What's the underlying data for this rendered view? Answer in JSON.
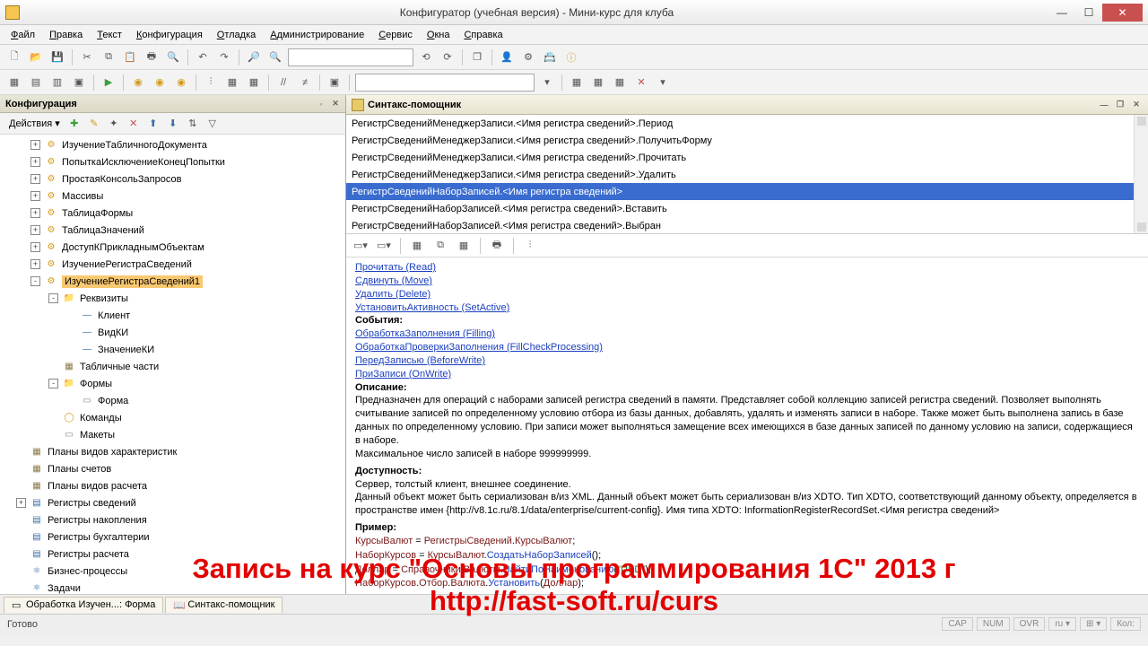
{
  "window": {
    "title": "Конфигуратор (учебная версия) - Мини-курс для клуба"
  },
  "menu": [
    "Файл",
    "Правка",
    "Текст",
    "Конфигурация",
    "Отладка",
    "Администрирование",
    "Сервис",
    "Окна",
    "Справка"
  ],
  "config_panel": {
    "title": "Конфигурация",
    "actions_label": "Действия ▾",
    "tree": [
      {
        "pad": 0,
        "pm": "+",
        "icon": "gear",
        "text": "ИзучениеТабличногоДокумента"
      },
      {
        "pad": 0,
        "pm": "+",
        "icon": "gear",
        "text": "ПопыткаИсключениеКонецПопытки"
      },
      {
        "pad": 0,
        "pm": "+",
        "icon": "gear",
        "text": "ПростаяКонсольЗапросов"
      },
      {
        "pad": 0,
        "pm": "+",
        "icon": "gear",
        "text": "Массивы"
      },
      {
        "pad": 0,
        "pm": "+",
        "icon": "gear",
        "text": "ТаблицаФормы"
      },
      {
        "pad": 0,
        "pm": "+",
        "icon": "gear",
        "text": "ТаблицаЗначений"
      },
      {
        "pad": 0,
        "pm": "+",
        "icon": "gear",
        "text": "ДоступКПрикладнымОбъектам"
      },
      {
        "pad": 0,
        "pm": "+",
        "icon": "gear",
        "text": "ИзучениеРегистраСведений"
      },
      {
        "pad": 0,
        "pm": "-",
        "icon": "gear",
        "text": "ИзучениеРегистраСведений1",
        "selected": true
      },
      {
        "pad": 1,
        "pm": "-",
        "icon": "folder",
        "text": "Реквизиты"
      },
      {
        "pad": 2,
        "pm": "",
        "icon": "dash",
        "text": "Клиент"
      },
      {
        "pad": 2,
        "pm": "",
        "icon": "dash",
        "text": "ВидКИ"
      },
      {
        "pad": 2,
        "pm": "",
        "icon": "dash",
        "text": "ЗначениеКИ"
      },
      {
        "pad": 1,
        "pm": "",
        "icon": "table",
        "text": "Табличные части"
      },
      {
        "pad": 1,
        "pm": "-",
        "icon": "folder",
        "text": "Формы"
      },
      {
        "pad": 2,
        "pm": "",
        "icon": "layout",
        "text": "Форма"
      },
      {
        "pad": 1,
        "pm": "",
        "icon": "cmd",
        "text": "Команды"
      },
      {
        "pad": 1,
        "pm": "",
        "icon": "layout",
        "text": "Макеты"
      },
      {
        "pad": -1,
        "pm": "",
        "icon": "table",
        "text": "Планы видов характеристик"
      },
      {
        "pad": -1,
        "pm": "",
        "icon": "table",
        "text": "Планы счетов"
      },
      {
        "pad": -1,
        "pm": "",
        "icon": "table",
        "text": "Планы видов расчета"
      },
      {
        "pad": -1,
        "pm": "+",
        "icon": "reg",
        "text": "Регистры сведений"
      },
      {
        "pad": -1,
        "pm": "",
        "icon": "reg",
        "text": "Регистры накопления"
      },
      {
        "pad": -1,
        "pm": "",
        "icon": "reg",
        "text": "Регистры бухгалтерии"
      },
      {
        "pad": -1,
        "pm": "",
        "icon": "reg",
        "text": "Регистры расчета"
      },
      {
        "pad": -1,
        "pm": "",
        "icon": "biz",
        "text": "Бизнес-процессы"
      },
      {
        "pad": -1,
        "pm": "",
        "icon": "biz",
        "text": "Задачи"
      }
    ]
  },
  "syntax_panel": {
    "title": "Синтакс-помощник",
    "nav": [
      {
        "t": "РегистрСведенийМенеджерЗаписи.<Имя регистра сведений>.Период"
      },
      {
        "t": "РегистрСведенийМенеджерЗаписи.<Имя регистра сведений>.ПолучитьФорму"
      },
      {
        "t": "РегистрСведенийМенеджерЗаписи.<Имя регистра сведений>.Прочитать"
      },
      {
        "t": "РегистрСведенийМенеджерЗаписи.<Имя регистра сведений>.Удалить"
      },
      {
        "t": "РегистрСведенийНаборЗаписей.<Имя регистра сведений>",
        "sel": true
      },
      {
        "t": "РегистрСведенийНаборЗаписей.<Имя регистра сведений>.Вставить"
      },
      {
        "t": "РегистрСведенийНаборЗаписей.<Имя регистра сведений>.Выбран"
      }
    ],
    "methods": [
      "Прочитать (Read)",
      "Сдвинуть (Move)",
      "Удалить (Delete)",
      "УстановитьАктивность (SetActive)"
    ],
    "events_label": "События:",
    "events": [
      "ОбработкаЗаполнения (Filling)",
      "ОбработкаПроверкиЗаполнения (FillCheckProcessing)",
      "ПередЗаписью (BeforeWrite)",
      "ПриЗаписи (OnWrite)"
    ],
    "desc_label": "Описание:",
    "desc": "Предназначен для операций с наборами записей регистра сведений в памяти. Представляет собой коллекцию записей регистра сведений. Позволяет выполнять считывание записей по определенному условию отбора из базы данных, добавлять, удалять и изменять записи в наборе. Также может быть выполнена запись в базе данных по определенному условию. При записи может выполняться замещение всех имеющихся в базе данных записей по данному условию на записи, содержащиеся в наборе.",
    "desc2": "Максимальное число записей в наборе 999999999.",
    "avail_label": "Доступность:",
    "avail": "Сервер, толстый клиент, внешнее соединение.",
    "avail2": "Данный объект может быть сериализован в/из XML. Данный объект может быть сериализован в/из XDTO. Тип XDTO, соответствующий данному объекту, определяется в пространстве имен {http://v8.1c.ru/8.1/data/enterprise/current-config}. Имя типа XDTO: InformationRegisterRecordSet.<Имя регистра сведений>",
    "example_label": "Пример:",
    "code": {
      "l1a": "КурсыВалют",
      "l1b": " = ",
      "l1c": "РегистрыСведений",
      "l1d": ".",
      "l1e": "КурсыВалют",
      "l1f": ";",
      "l2a": "НаборКурсов",
      "l2b": " = ",
      "l2c": "КурсыВалют",
      "l2d": ".",
      "l2e": "СоздатьНаборЗаписей",
      "l2f": "();",
      "l3a": "Доллар",
      "l3b": " = ",
      "l3c": "Справочники",
      "l3d": ".",
      "l3e": "Валюты",
      "l3f": ".",
      "l3g": "НайтиПоНаименованию",
      "l3h": "(",
      "l3i": "\"USD\"",
      "l3j": ");",
      "l4a": "НаборКурсов",
      "l4b": ".",
      "l4c": "Отбор",
      "l4d": ".",
      "l4e": "Валюта",
      "l4f": ".",
      "l4g": "Установить",
      "l4h": "(",
      "l4i": "Доллар",
      "l4j": ");"
    }
  },
  "tabs": [
    {
      "icon": "layout",
      "label": "Обработка Изучен...: Форма"
    },
    {
      "icon": "help",
      "label": "Синтакс-помощник"
    }
  ],
  "status": {
    "ready": "Готово",
    "items": [
      "CAP",
      "NUM",
      "OVR",
      "ru ▾",
      "⊞ ▾",
      "Кол:"
    ]
  },
  "overlay": {
    "line1": "Запись на курс \"Основы программирования 1С\" 2013 г",
    "line2": "http://fast-soft.ru/curs"
  }
}
